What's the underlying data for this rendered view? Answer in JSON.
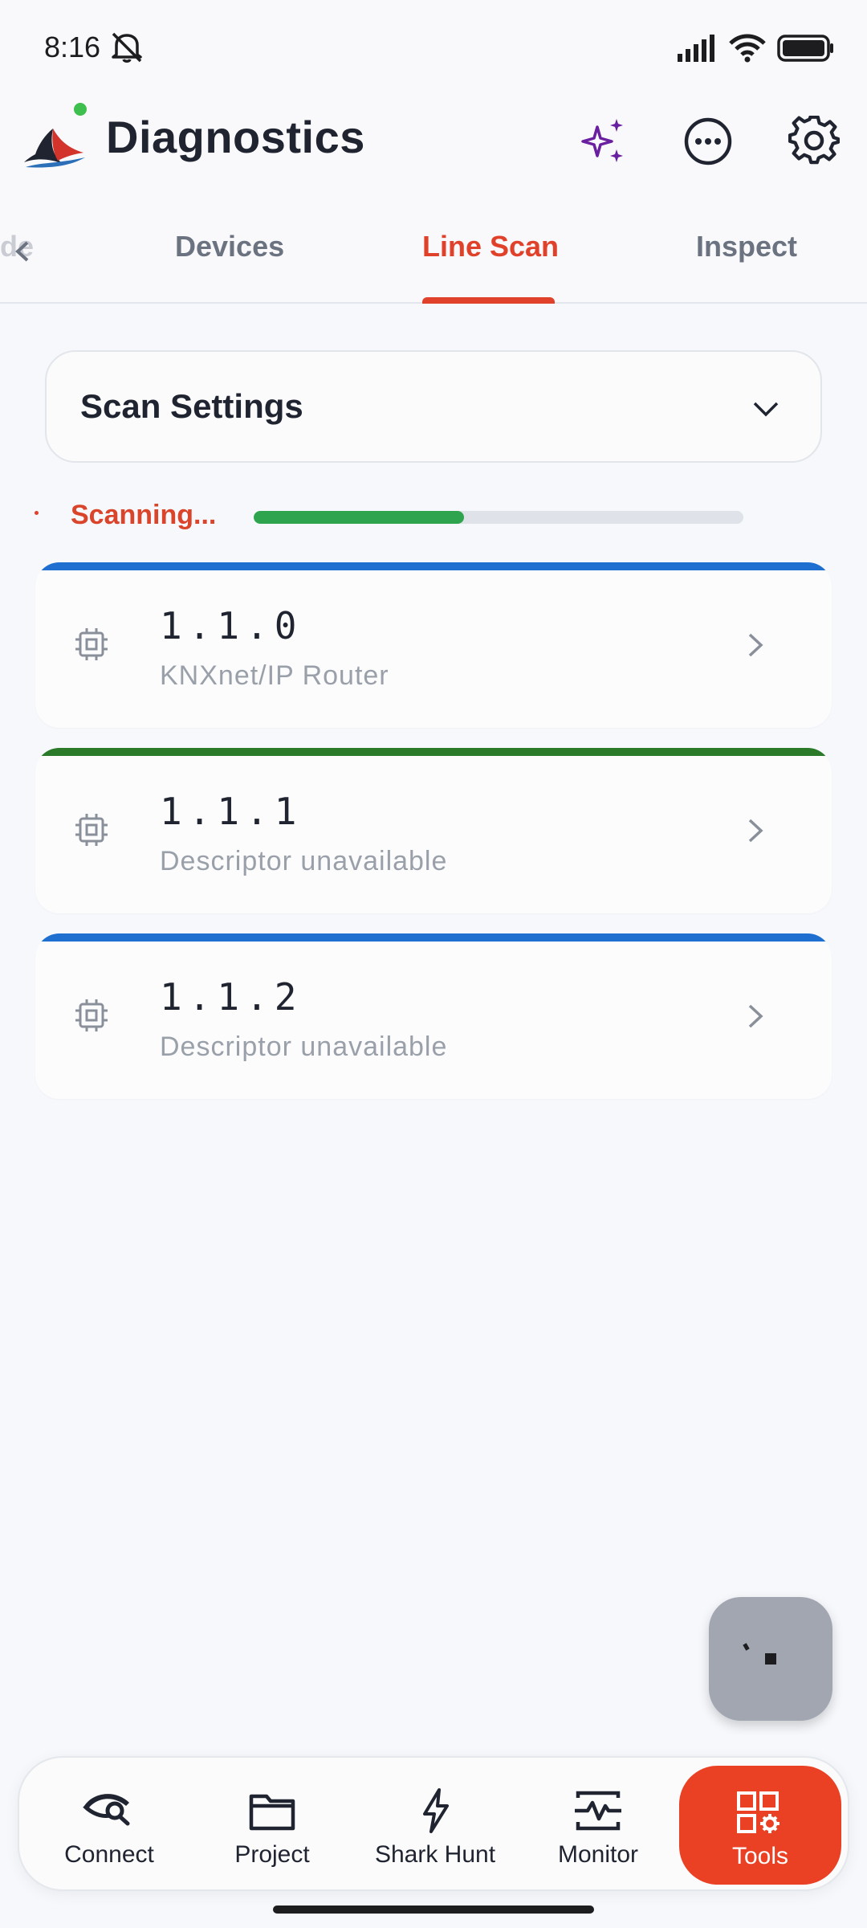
{
  "status": {
    "time": "8:16"
  },
  "app": {
    "title": "Diagnostics"
  },
  "tabs": {
    "partial": "de",
    "items": [
      "Devices",
      "Line Scan",
      "Inspect"
    ],
    "active": "Line Scan"
  },
  "scan_settings": {
    "title": "Scan Settings"
  },
  "scan": {
    "label": "Scanning...",
    "progress": 0.43
  },
  "devices": [
    {
      "address": "1.1.0",
      "descriptor": "KNXnet/IP Router",
      "accent": "#1f6fd1"
    },
    {
      "address": "1.1.1",
      "descriptor": "Descriptor unavailable",
      "accent": "#2a7a2a"
    },
    {
      "address": "1.1.2",
      "descriptor": "Descriptor unavailable",
      "accent": "#1f6fd1"
    }
  ],
  "nav": {
    "connect": "Connect",
    "project": "Project",
    "shark_hunt": "Shark Hunt",
    "monitor": "Monitor",
    "tools": "Tools"
  },
  "colors": {
    "accent": "#e0412a",
    "progress": "#2ea44f",
    "sparkle": "#6a1fa0"
  }
}
